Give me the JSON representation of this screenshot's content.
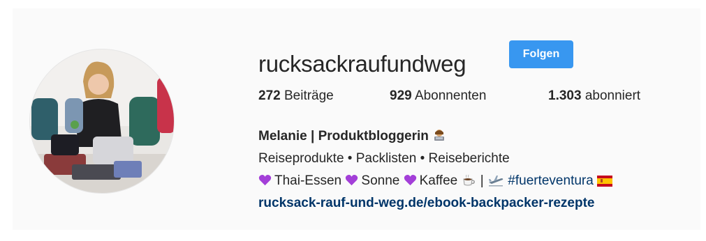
{
  "profile": {
    "username": "rucksackraufundweg",
    "follow_button": "Folgen"
  },
  "stats": [
    {
      "count": "272",
      "label": "Beiträge"
    },
    {
      "count": "929",
      "label": "Abonnenten"
    },
    {
      "count": "1.303",
      "label": "abonniert"
    }
  ],
  "bio": {
    "name": "Melanie | Produktbloggerin",
    "line1": "Reiseprodukte • Packlisten • Reiseberichte",
    "line2_items": [
      "Thai-Essen",
      "Sonne",
      "Kaffee"
    ],
    "separator": "|",
    "hashtag": "#fuerteventura",
    "link": "rucksack-rauf-und-weg.de/ebook-backpacker-rezepte"
  },
  "colors": {
    "follow_bg": "#3897f0",
    "link": "#003569",
    "heart": "#a33fd8"
  },
  "icons": {
    "name_emoji": "woman-technologist-icon",
    "hearts": "purple-heart-icon",
    "coffee": "hot-beverage-icon",
    "plane": "airplane-icon",
    "flag": "spain-flag-icon"
  }
}
